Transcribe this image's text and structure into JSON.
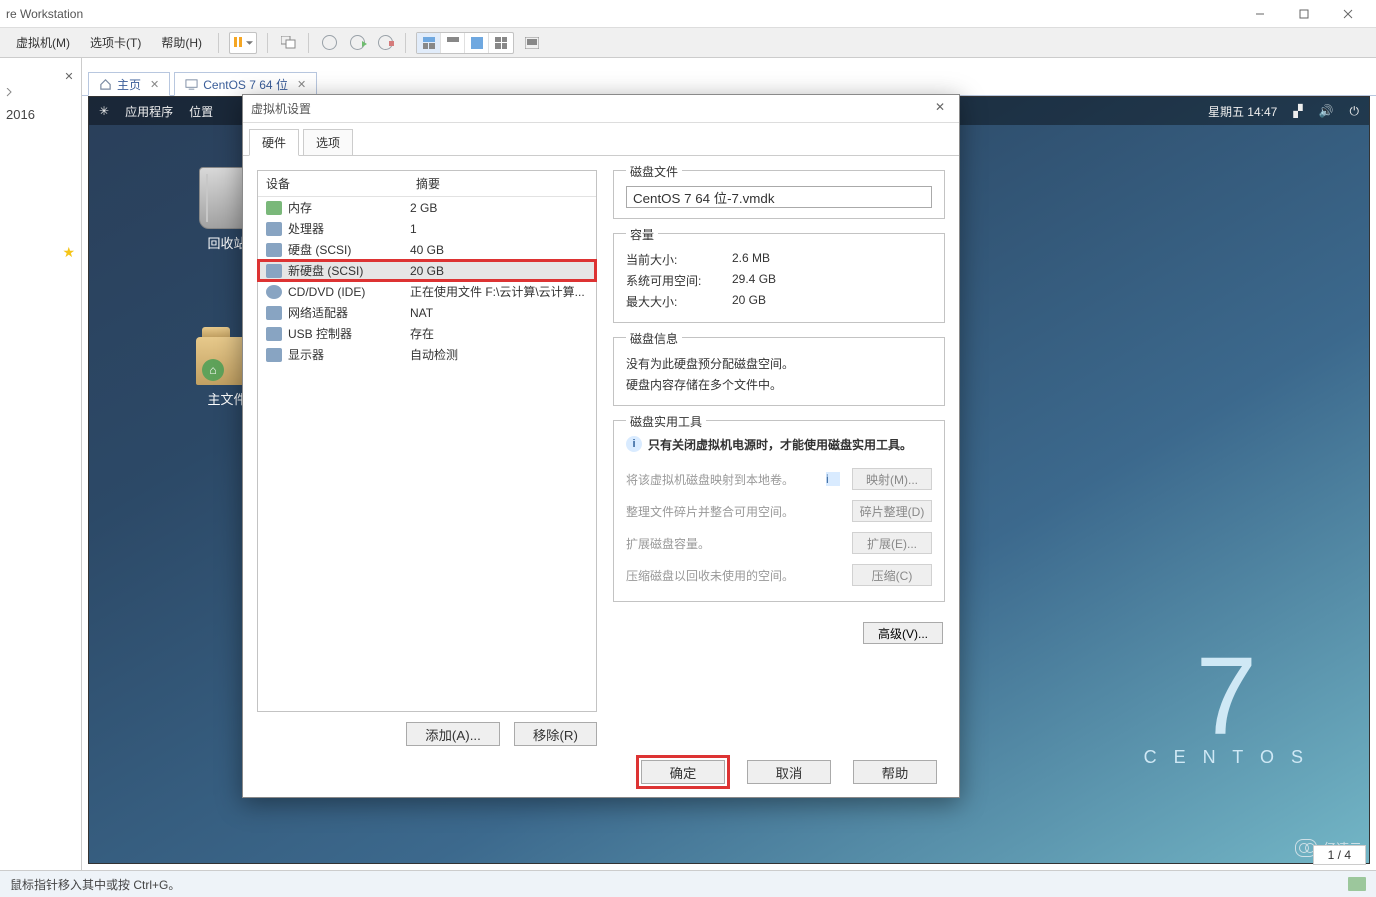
{
  "window": {
    "title": "re Workstation"
  },
  "menu": [
    "虚拟机(M)",
    "选项卡(T)",
    "帮助(H)"
  ],
  "leftPanel": {
    "item1": "2016"
  },
  "tabs": {
    "home": "主页",
    "vm": "CentOS 7 64 位"
  },
  "vm_desktop": {
    "apps": "应用程序",
    "places": "位置",
    "clock": "星期五 14:47",
    "trash_label": "回收站",
    "home_label": "主文件",
    "centos_big": "7",
    "centos_word": "C E N T O S"
  },
  "dialog": {
    "title": "虚拟机设置",
    "tabs": {
      "hardware": "硬件",
      "options": "选项"
    },
    "headers": {
      "device": "设备",
      "summary": "摘要"
    },
    "devices": [
      {
        "name": "内存",
        "summary": "2 GB"
      },
      {
        "name": "处理器",
        "summary": "1"
      },
      {
        "name": "硬盘 (SCSI)",
        "summary": "40 GB"
      },
      {
        "name": "新硬盘 (SCSI)",
        "summary": "20 GB"
      },
      {
        "name": "CD/DVD (IDE)",
        "summary": "正在使用文件 F:\\云计算\\云计算..."
      },
      {
        "name": "网络适配器",
        "summary": "NAT"
      },
      {
        "name": "USB 控制器",
        "summary": "存在"
      },
      {
        "name": "显示器",
        "summary": "自动检测"
      }
    ],
    "add_btn": "添加(A)...",
    "remove_btn": "移除(R)",
    "disk_file_title": "磁盘文件",
    "disk_file_value": "CentOS 7 64 位-7.vmdk",
    "capacity_title": "容量",
    "capacity": {
      "curr_label": "当前大小:",
      "curr_val": "2.6 MB",
      "avail_label": "系统可用空间:",
      "avail_val": "29.4 GB",
      "max_label": "最大大小:",
      "max_val": "20 GB"
    },
    "info_title": "磁盘信息",
    "info_line1": "没有为此硬盘预分配磁盘空间。",
    "info_line2": "硬盘内容存储在多个文件中。",
    "util_title": "磁盘实用工具",
    "util_note": "只有关闭虚拟机电源时，才能使用磁盘实用工具。",
    "util_rows": {
      "map_txt": "将该虚拟机磁盘映射到本地卷。",
      "map_btn": "映射(M)...",
      "defrag_txt": "整理文件碎片并整合可用空间。",
      "defrag_btn": "碎片整理(D)",
      "expand_txt": "扩展磁盘容量。",
      "expand_btn": "扩展(E)...",
      "compact_txt": "压缩磁盘以回收未使用的空间。",
      "compact_btn": "压缩(C)"
    },
    "adv_btn": "高级(V)...",
    "footer": {
      "ok": "确定",
      "cancel": "取消",
      "help": "帮助"
    }
  },
  "watermark": "亿速云",
  "page_counter": "1 / 4",
  "status": "鼠标指针移入其中或按 Ctrl+G。"
}
